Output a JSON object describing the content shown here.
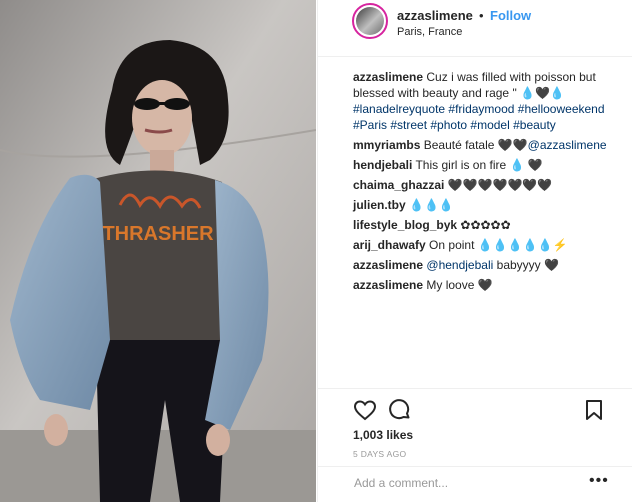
{
  "post": {
    "image_alt": "",
    "user": {
      "username": "azzaslimene",
      "separator": "•",
      "follow_label": "Follow",
      "location": "Paris, France"
    },
    "caption": {
      "username": "azzaslimene",
      "text": "Cuz i was filled with poisson but blessed with beauty and rage \" 💧🖤💧",
      "hashtags": "#lanadelreyquote #fridaymood #hellooweekend #Paris #street #photo #model #beauty"
    },
    "comments": [
      {
        "username": "mmyriambs",
        "text": "Beauté fatale 🖤🖤",
        "mention": "@azzaslimene"
      },
      {
        "username": "hendjebali",
        "text": "This girl is on fire 💧 🖤",
        "mention": ""
      },
      {
        "username": "chaima_ghazzai",
        "text": "🖤🖤🖤🖤🖤🖤🖤",
        "mention": ""
      },
      {
        "username": "julien.tby",
        "text": "💧💧💧",
        "mention": ""
      },
      {
        "username": "lifestyle_blog_byk",
        "text": "✿✿✿✿✿",
        "mention": ""
      },
      {
        "username": "arij_dhawafy",
        "text": "On point 💧💧💧💧💧⚡",
        "mention": ""
      },
      {
        "username": "azzaslimene",
        "text": "babyyyy 🖤",
        "mention": "@hendjebali"
      },
      {
        "username": "azzaslimene",
        "text": "My loove 🖤",
        "mention": ""
      }
    ],
    "likes": "1,003 likes",
    "time_ago": "5 DAYS AGO",
    "add_comment_placeholder": "Add a comment...",
    "more_label": "•••",
    "icons": [
      "heart-icon",
      "comment-icon",
      "bookmark-icon"
    ]
  }
}
